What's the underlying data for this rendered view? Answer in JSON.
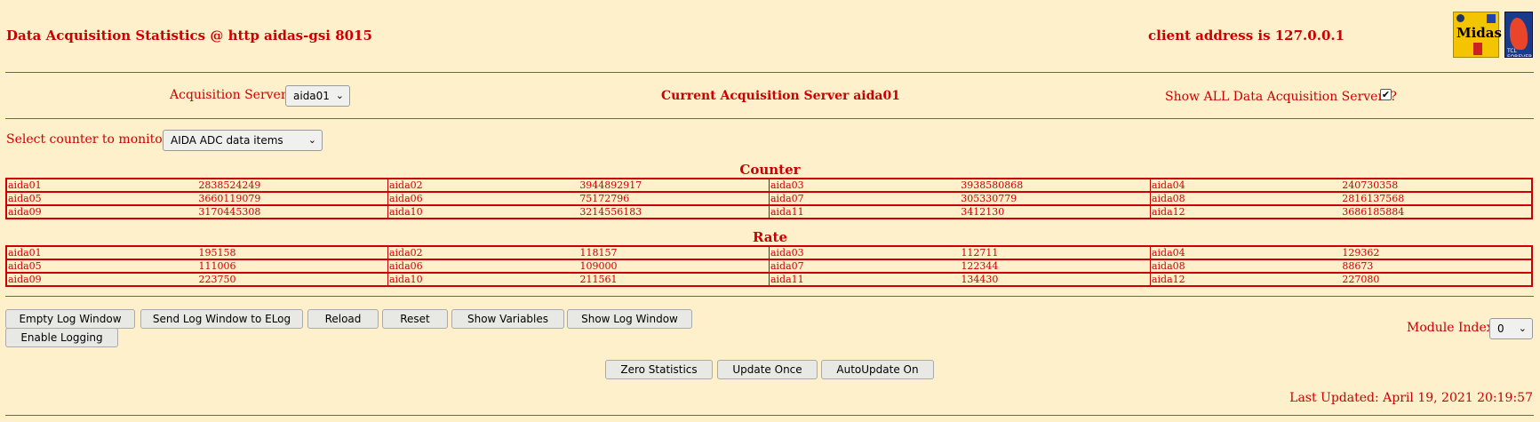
{
  "header": {
    "title": "Data Acquisition Statistics @ http aidas-gsi 8015",
    "client": "client address is 127.0.0.1",
    "logo1_text": "Midas",
    "logo2_text": "TCL FOREVER"
  },
  "acq": {
    "servers_label": "Acquisition Servers",
    "server_selected": "aida01",
    "current_label": "Current Acquisition Server aida01",
    "show_all_label": "Show ALL Data Acquisition Servers?",
    "show_all_checked": true
  },
  "counter_select": {
    "label": "Select counter to monitor",
    "selected": "AIDA ADC data items"
  },
  "counter": {
    "heading": "Counter",
    "rows": [
      [
        [
          "aida01",
          "2838524249"
        ],
        [
          "aida02",
          "3944892917"
        ],
        [
          "aida03",
          "3938580868"
        ],
        [
          "aida04",
          "240730358"
        ]
      ],
      [
        [
          "aida05",
          "3660119079"
        ],
        [
          "aida06",
          "75172796"
        ],
        [
          "aida07",
          "305330779"
        ],
        [
          "aida08",
          "2816137568"
        ]
      ],
      [
        [
          "aida09",
          "3170445308"
        ],
        [
          "aida10",
          "3214556183"
        ],
        [
          "aida11",
          "3412130"
        ],
        [
          "aida12",
          "3686185884"
        ]
      ]
    ]
  },
  "rate": {
    "heading": "Rate",
    "rows": [
      [
        [
          "aida01",
          "195158"
        ],
        [
          "aida02",
          "118157"
        ],
        [
          "aida03",
          "112711"
        ],
        [
          "aida04",
          "129362"
        ]
      ],
      [
        [
          "aida05",
          "111006"
        ],
        [
          "aida06",
          "109000"
        ],
        [
          "aida07",
          "122344"
        ],
        [
          "aida08",
          "88673"
        ]
      ],
      [
        [
          "aida09",
          "223750"
        ],
        [
          "aida10",
          "211561"
        ],
        [
          "aida11",
          "134430"
        ],
        [
          "aida12",
          "227080"
        ]
      ]
    ]
  },
  "buttons": {
    "empty_log": "Empty Log Window",
    "send_log": "Send Log Window to ELog",
    "reload": "Reload",
    "reset": "Reset",
    "show_vars": "Show Variables",
    "show_log": "Show Log Window",
    "enable_logging": "Enable Logging",
    "zero_stats": "Zero Statistics",
    "update_once": "Update Once",
    "autoupdate": "AutoUpdate On"
  },
  "module": {
    "label": "Module Index",
    "value": "0"
  },
  "footer": {
    "last_updated": "Last Updated: April 19, 2021 20:19:57"
  }
}
